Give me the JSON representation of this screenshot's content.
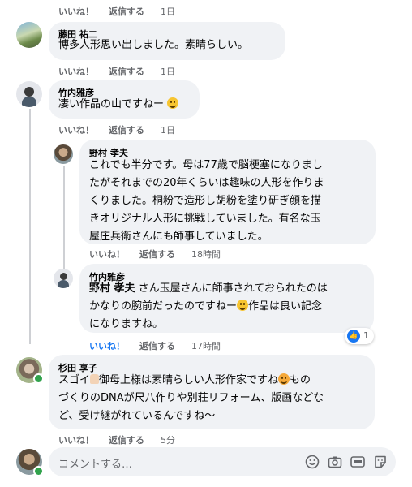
{
  "top_actions": {
    "like": "いいね！",
    "reply": "返信する",
    "time": "1日"
  },
  "comments": [
    {
      "author": "藤田 祐二",
      "lines": [
        "博多人形思い出しました。素晴らしい。"
      ],
      "like": "いいね！",
      "reply": "返信する",
      "time": "1日"
    },
    {
      "author": "竹内雅彦",
      "lines": [
        "凄い作品の山ですねー"
      ],
      "like": "いいね！",
      "reply": "返信する",
      "time": "1日"
    },
    {
      "author": "野村 孝夫",
      "lines": [
        "これでも半分です。母は77歳で脳梗塞になりまし",
        "たがそれまでの20年くらいは趣味の人形を作りま",
        "くりました。桐粉で造形し胡粉を塗り研ぎ顔を描",
        "きオリジナル人形に挑戦していました。有名な玉",
        "屋庄兵衛さんにも師事していました。"
      ],
      "like": "いいね！",
      "reply": "返信する",
      "time": "18時間"
    },
    {
      "author": "竹内雅彦",
      "mention": "野村 孝夫",
      "line1_rest": "さん玉屋さんに師事されておられたのは",
      "line2a": "かなりの腕前だったのですねー",
      "line2b": "作品は良い記念",
      "line3": "になりますね。",
      "reaction_count": "1",
      "like": "いいね！",
      "reply": "返信する",
      "time": "17時間"
    },
    {
      "author": "杉田 享子",
      "line1a": "スゴイ",
      "line1b": "御母上様は素晴らしい人形作家ですね",
      "line1c": "もの",
      "line2": "づくりのDNAが尺八作りや別荘リフォーム、版画などな",
      "line3": "ど、受け継がれているんですね〜",
      "like": "いいね！",
      "reply": "返信する",
      "time": "5分"
    }
  ],
  "composer": {
    "placeholder": "コメントする…",
    "icons": [
      "emoji-icon",
      "camera-icon",
      "gif-icon",
      "sticker-icon"
    ]
  },
  "colors": {
    "bubble": "#f0f2f5",
    "meta": "#65676b",
    "online": "#31a24c",
    "like_blue": "#1877f2"
  }
}
